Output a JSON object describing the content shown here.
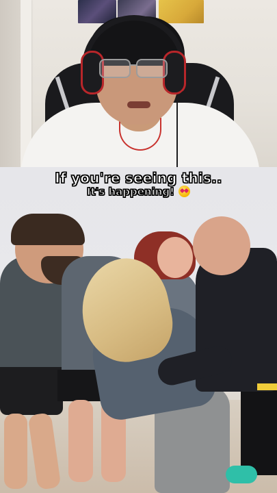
{
  "caption": {
    "line1": "If you're seeing this..",
    "line2": "It's happening!",
    "emoji_icon": "heart-eyes-emoji"
  },
  "colors": {
    "caption_text": "#ffffff",
    "caption_outline": "#000000",
    "backdrop": "#e6e6ea"
  }
}
